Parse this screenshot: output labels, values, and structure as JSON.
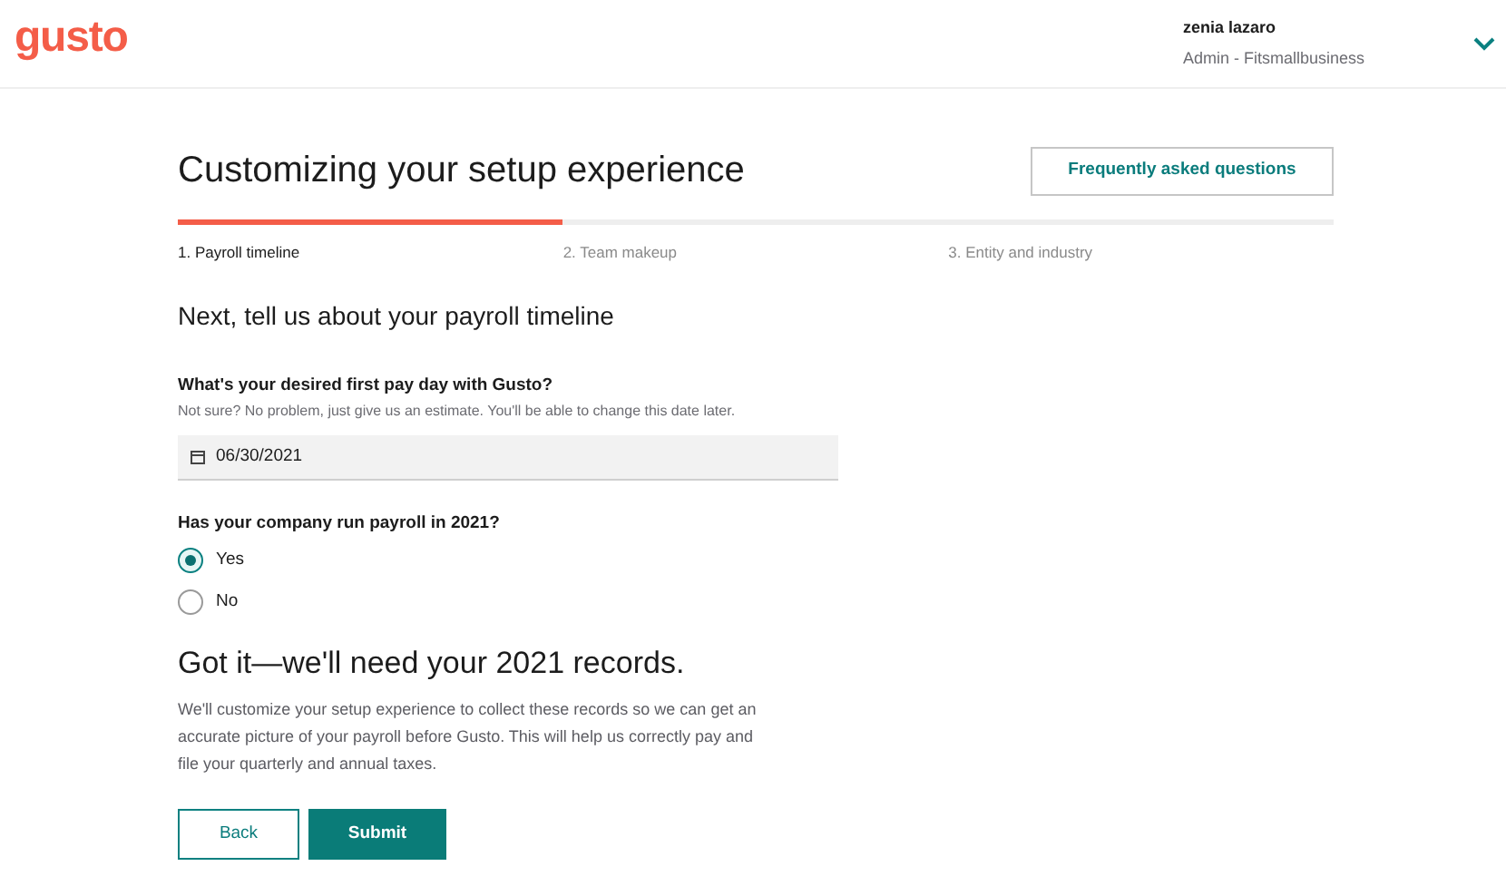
{
  "header": {
    "logo": "gusto",
    "user_name": "zenia lazaro",
    "user_role": "Admin - Fitsmallbusiness"
  },
  "page": {
    "title": "Customizing your setup experience",
    "faq_button": "Frequently asked questions"
  },
  "steps": [
    {
      "label": "1. Payroll timeline",
      "selected": true
    },
    {
      "label": "2. Team makeup",
      "selected": false
    },
    {
      "label": "3. Entity and industry",
      "selected": false
    }
  ],
  "form": {
    "heading": "Next, tell us about your payroll timeline",
    "date_label": "What's your desired first pay day with Gusto?",
    "date_hint": "Not sure? No problem, just give us an estimate. You'll be able to change this date later.",
    "date_value": "06/30/2021",
    "question": "Has your company run payroll in 2021?",
    "options": [
      {
        "label": "Yes",
        "selected": true
      },
      {
        "label": "No",
        "selected": false
      }
    ],
    "result_heading": "Got it—we'll need your 2021 records.",
    "result_text": "We'll customize your setup experience to collect these records so we can get an accurate picture of your payroll before Gusto. This will help us correctly pay and file your quarterly and annual taxes."
  },
  "buttons": {
    "back": "Back",
    "submit": "Submit"
  }
}
